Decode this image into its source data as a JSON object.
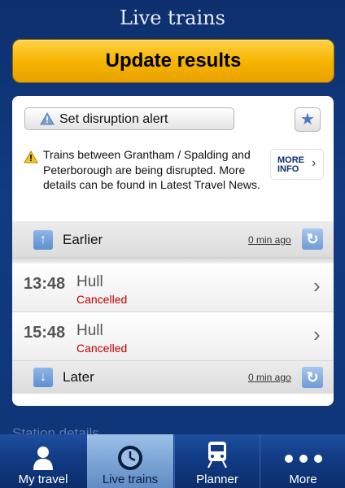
{
  "header": {
    "title": "Live trains"
  },
  "update_button": {
    "label": "Update results"
  },
  "alert": {
    "label": "Set disruption alert"
  },
  "disruption": {
    "message": "Trains between Grantham / Spalding and Peterborough are being disrupted. More details can be found in Latest Travel News.",
    "more_info_line1": "MORE",
    "more_info_line2": "INFO"
  },
  "earlier": {
    "label": "Earlier",
    "updated": "0 min ago"
  },
  "later": {
    "label": "Later",
    "updated": "0 min ago"
  },
  "trains": [
    {
      "time": "13:48",
      "destination": "Hull",
      "status": "Cancelled"
    },
    {
      "time": "15:48",
      "destination": "Hull",
      "status": "Cancelled"
    }
  ],
  "bottom_partial_text": "Station details",
  "tabs": [
    {
      "label": "My travel",
      "icon": "person-icon"
    },
    {
      "label": "Live trains",
      "icon": "clock-icon",
      "active": true
    },
    {
      "label": "Planner",
      "icon": "train-icon"
    },
    {
      "label": "More",
      "icon": "more-dots-icon"
    }
  ],
  "colors": {
    "accent": "#f7b500",
    "brand": "#123b82",
    "cancelled": "#c00000"
  }
}
